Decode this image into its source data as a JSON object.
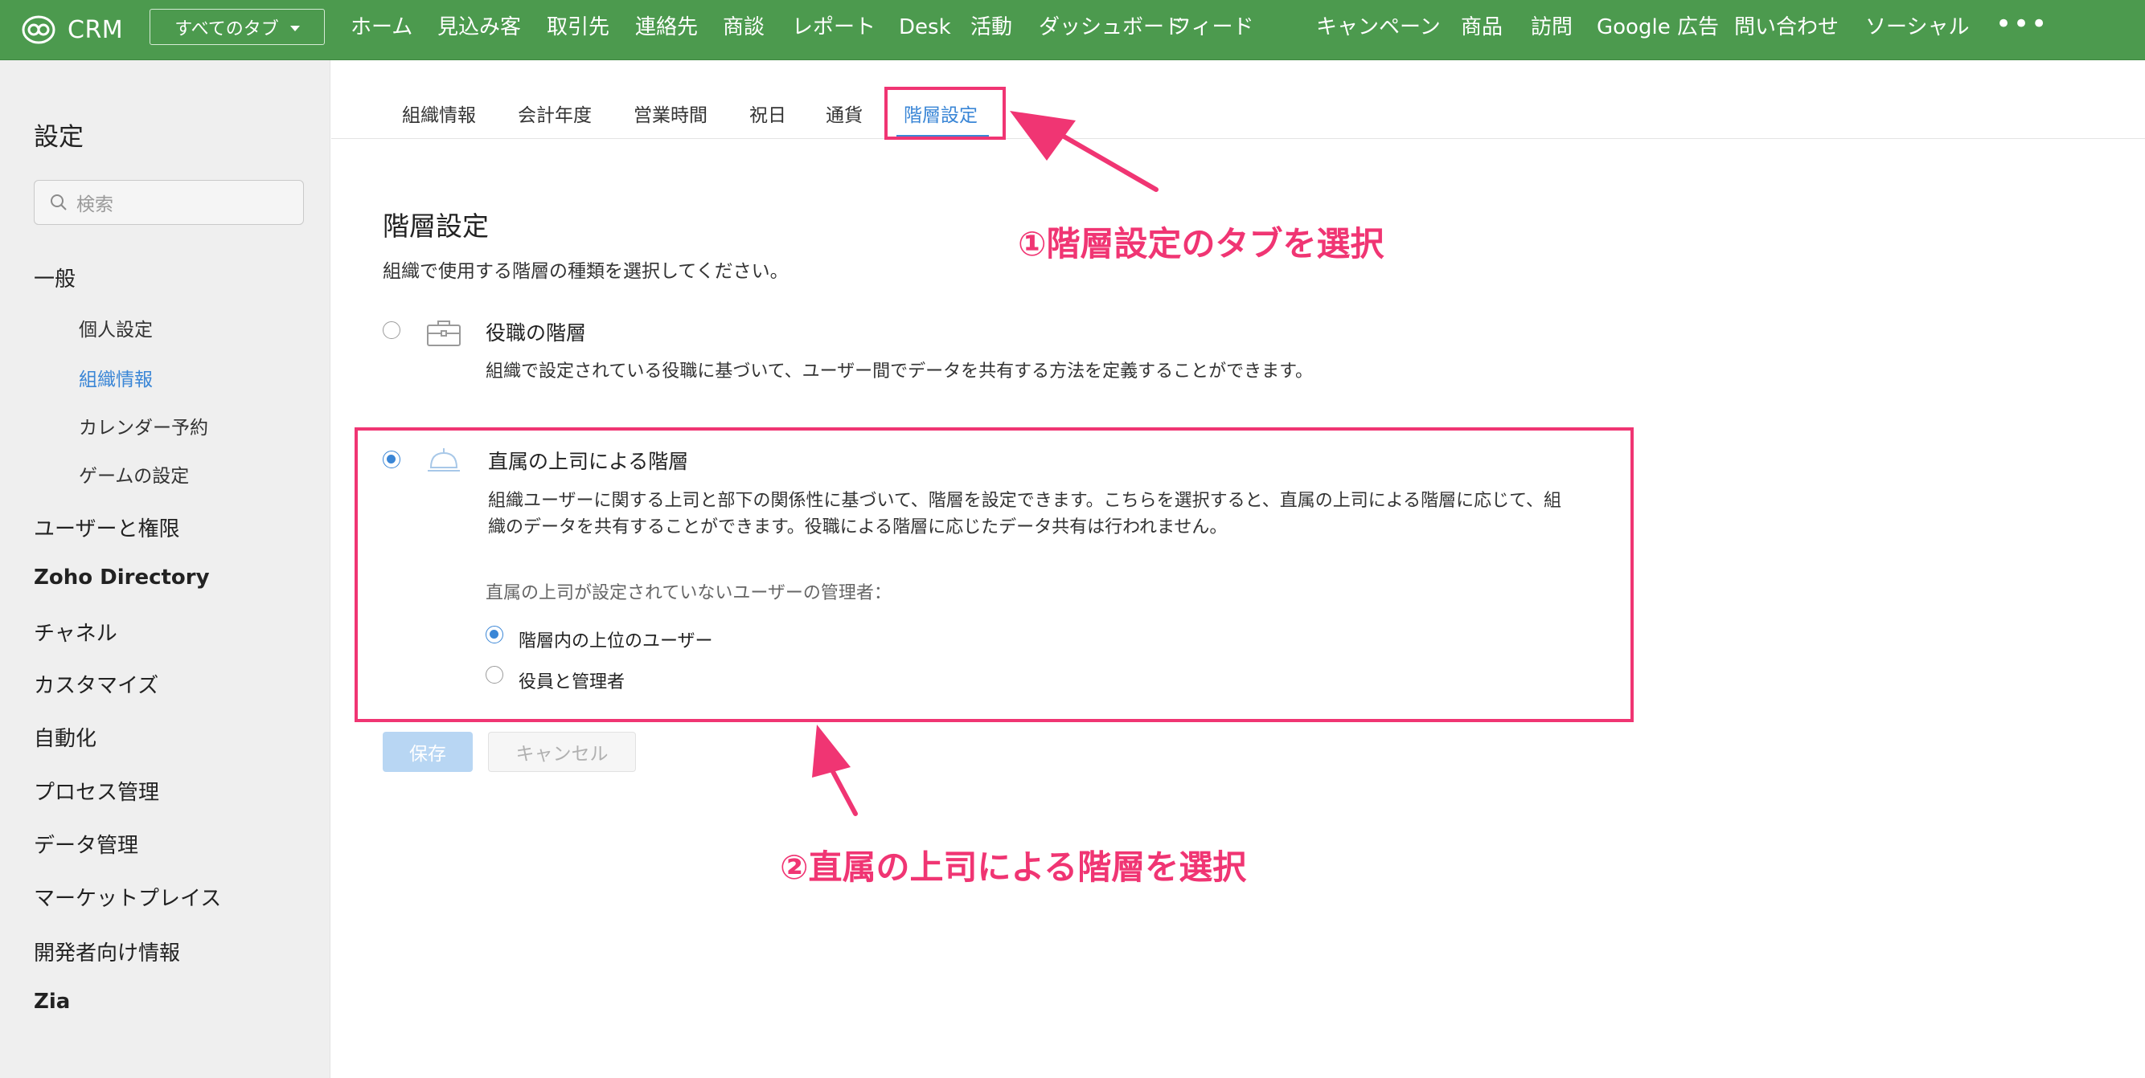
{
  "topbar": {
    "logo_text": "CRM",
    "all_tabs_label": "すべてのタブ",
    "nav_items": [
      "ホーム",
      "見込み客",
      "取引先",
      "連絡先",
      "商談",
      "レポート",
      "Desk",
      "活動",
      "ダッシュボード",
      "フィード",
      "キャンペーン",
      "商品",
      "訪問",
      "Google 広告",
      "問い合わせ",
      "ソーシャル"
    ],
    "more_label": "•••"
  },
  "sidebar": {
    "title": "設定",
    "search_placeholder": "検索",
    "general": "一般",
    "sub_items": [
      "個人設定",
      "組織情報",
      "カレンダー予約",
      "ゲームの設定"
    ],
    "active_sub": "組織情報",
    "categories": [
      "ユーザーと権限",
      "Zoho Directory",
      "チャネル",
      "カスタマイズ",
      "自動化",
      "プロセス管理",
      "データ管理",
      "マーケットプレイス",
      "開発者向け情報",
      "Zia"
    ]
  },
  "tabs": [
    "組織情報",
    "会計年度",
    "営業時間",
    "祝日",
    "通貨",
    "階層設定"
  ],
  "active_tab": "階層設定",
  "content": {
    "title": "階層設定",
    "description": "組織で使用する階層の種類を選択してください。",
    "option1": {
      "title": "役職の階層",
      "description": "組織で設定されている役職に基づいて、ユーザー間でデータを共有する方法を定義することができます。",
      "selected": false
    },
    "option2": {
      "title": "直属の上司による階層",
      "description_line1": "組織ユーザーに関する上司と部下の関係性に基づいて、階層を設定できます。こちらを選択すると、直属の上司による階層に応じて、組",
      "description_line2": "織のデータを共有することができます。役職による階層に応じたデータ共有は行われません。",
      "selected": true,
      "sub_label": "直属の上司が設定されていないユーザーの管理者：",
      "sub_options": [
        {
          "label": "階層内の上位のユーザー",
          "selected": true
        },
        {
          "label": "役員と管理者",
          "selected": false
        }
      ]
    },
    "save_label": "保存",
    "cancel_label": "キャンセル"
  },
  "annotations": {
    "step1": "①階層設定のタブを選択",
    "step2": "②直属の上司による階層を選択",
    "color": "#f03573"
  },
  "colors": {
    "topbar": "#4c9a4e",
    "accent": "#3a86d6",
    "sidebar_bg": "#efefef"
  }
}
